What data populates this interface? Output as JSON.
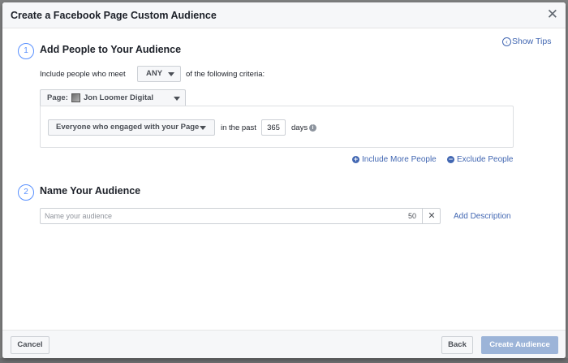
{
  "dialog": {
    "title": "Create a Facebook Page Custom Audience",
    "show_tips": "Show Tips"
  },
  "section1": {
    "number": "1",
    "title": "Add People to Your Audience",
    "include_prefix": "Include people who meet",
    "match_value": "ANY",
    "include_suffix": "of the following criteria:",
    "page_label": "Page:",
    "page_name": "Jon Loomer Digital",
    "engagement_option": "Everyone who engaged with your Page",
    "in_the_past": "in the past",
    "days_value": "365",
    "days_label": "days",
    "include_more": "Include More People",
    "exclude": "Exclude People"
  },
  "section2": {
    "number": "2",
    "title": "Name Your Audience",
    "name_placeholder": "Name your audience",
    "char_count": "50",
    "add_description": "Add Description"
  },
  "footer": {
    "cancel": "Cancel",
    "back": "Back",
    "create": "Create Audience"
  },
  "icons": {
    "close": "close-icon",
    "tips": "chevron-left-circle-icon",
    "info": "info-icon",
    "plus": "plus-circle-icon",
    "minus": "minus-circle-icon",
    "clear": "clear-icon"
  },
  "colors": {
    "link": "#4267b2",
    "step_circle": "#5890ff",
    "create_button_disabled": "#9cb4d8"
  }
}
